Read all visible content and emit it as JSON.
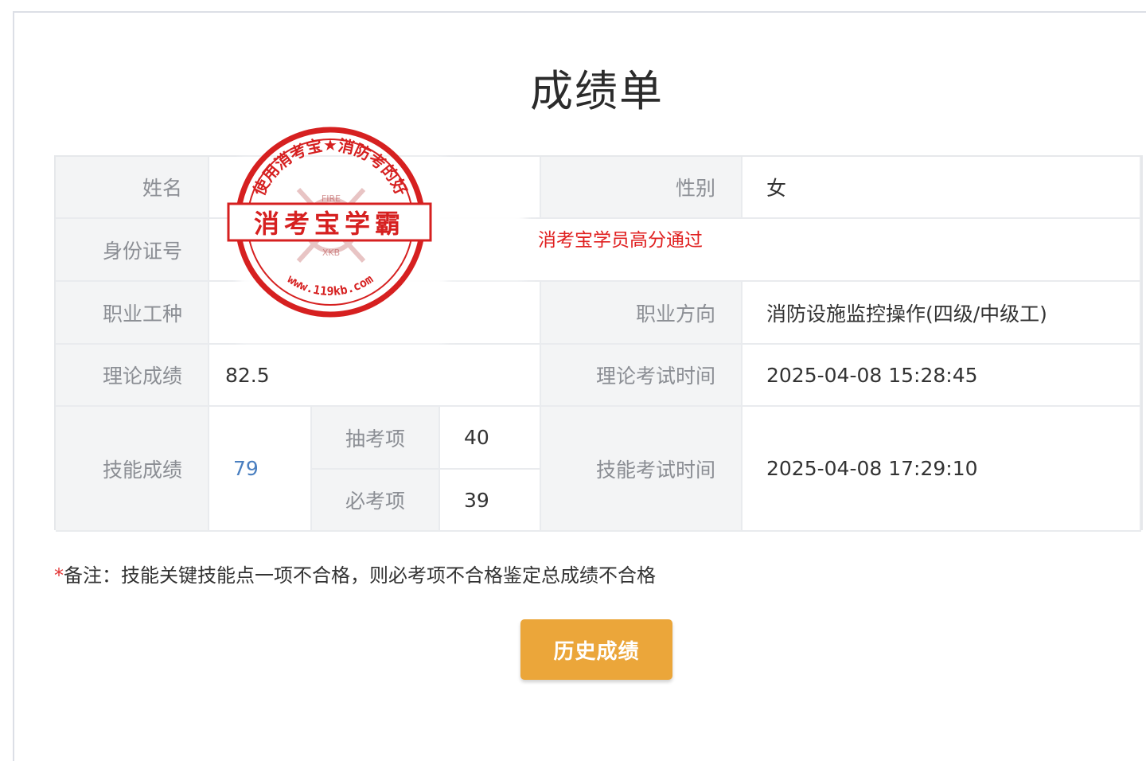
{
  "page": {
    "title": "成绩单"
  },
  "table": {
    "name_label": "姓名",
    "gender_label": "性别",
    "gender_value": "女",
    "id_label": "身份证号",
    "occupation_label": "职业工种",
    "direction_label": "职业方向",
    "direction_value": "消防设施监控操作(四级/中级工)",
    "theory_label": "理论成绩",
    "theory_value": "82.5",
    "theory_time_label": "理论考试时间",
    "theory_time_value": "2025-04-08 15:28:45",
    "skill_label": "技能成绩",
    "skill_value": "79",
    "draw_label": "抽考项",
    "draw_value": "40",
    "required_label": "必考项",
    "required_value": "39",
    "skill_time_label": "技能考试时间",
    "skill_time_value": "2025-04-08 17:29:10"
  },
  "overlay": {
    "passed_text": "消考宝学员高分通过"
  },
  "stamp": {
    "banner": "消考宝学霸",
    "ring_top": "使用消考宝★消防考的好",
    "ring_bottom": "www.119kb.com",
    "emblem_top": "FIRE",
    "emblem_bottom": "XKB",
    "color": "#d62020"
  },
  "note": {
    "star": "*",
    "text": "备注：技能关键技能点一项不合格，则必考项不合格鉴定总成绩不合格"
  },
  "buttons": {
    "history": "历史成绩"
  }
}
